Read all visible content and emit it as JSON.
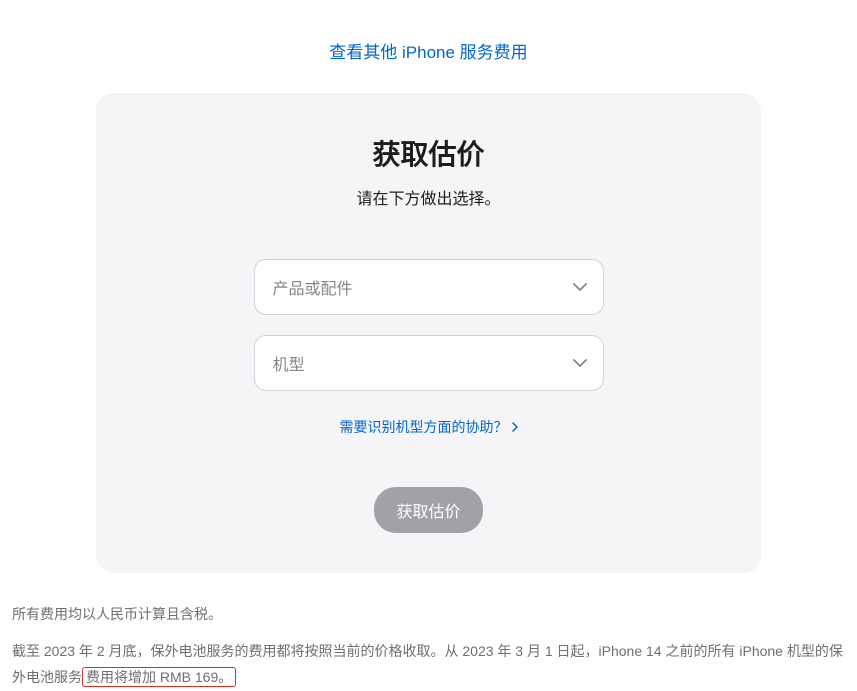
{
  "topLink": {
    "label": "查看其他 iPhone 服务费用"
  },
  "card": {
    "title": "获取估价",
    "subtitle": "请在下方做出选择。",
    "select1": {
      "placeholder": "产品或配件"
    },
    "select2": {
      "placeholder": "机型"
    },
    "helpLink": "需要识别机型方面的协助？",
    "submitLabel": "获取估价"
  },
  "footer": {
    "line1": "所有费用均以人民币计算且含税。",
    "line2_part1": "截至 2023 年 2 月底，保外电池服务的费用都将按照当前的价格收取。从 2023 年 3 月 1 日起，iPhone 14 之前的所有 iPhone 机型的保外电池服务",
    "line2_highlight": "费用将增加 RMB 169。"
  }
}
